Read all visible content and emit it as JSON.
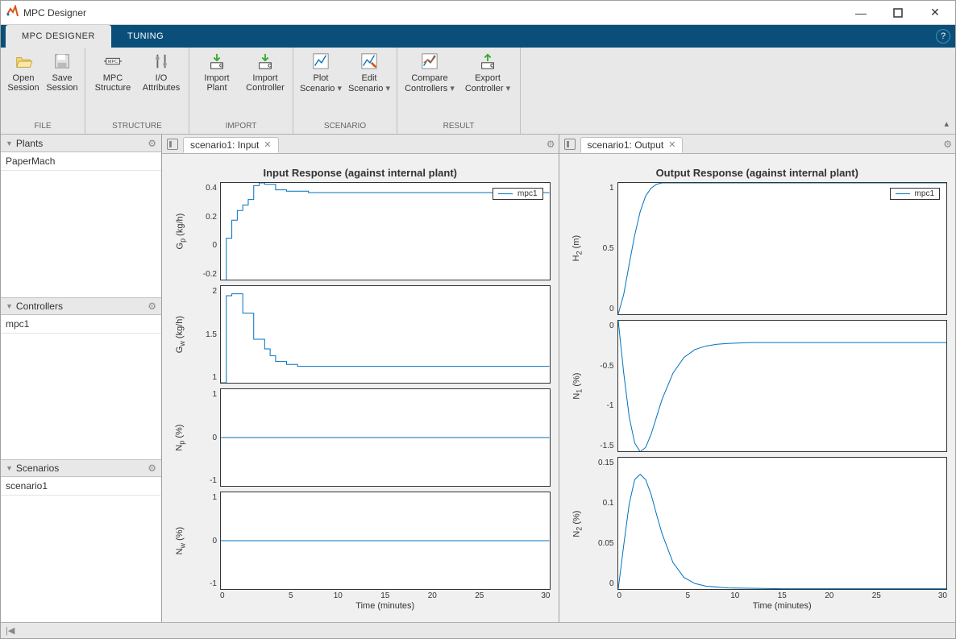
{
  "window": {
    "title": "MPC Designer"
  },
  "tabs": {
    "main": "MPC DESIGNER",
    "tuning": "TUNING"
  },
  "toolstrip": {
    "file": {
      "label": "FILE",
      "open": "Open\nSession",
      "save": "Save\nSession"
    },
    "structure": {
      "label": "STRUCTURE",
      "mpc": "MPC\nStructure",
      "io": "I/O\nAttributes"
    },
    "import": {
      "label": "IMPORT",
      "plant": "Import\nPlant",
      "controller": "Import\nController"
    },
    "scenario": {
      "label": "SCENARIO",
      "plot": "Plot\nScenario",
      "edit": "Edit\nScenario"
    },
    "result": {
      "label": "RESULT",
      "compare": "Compare\nControllers",
      "export": "Export\nController"
    }
  },
  "sidebar": {
    "plants": {
      "title": "Plants",
      "items": [
        "PaperMach"
      ]
    },
    "controllers": {
      "title": "Controllers",
      "items": [
        "mpc1"
      ]
    },
    "scenarios": {
      "title": "Scenarios",
      "items": [
        "scenario1"
      ]
    }
  },
  "panes": {
    "input": {
      "tab": "scenario1: Input",
      "title": "Input Response (against internal plant)",
      "legend": "mpc1"
    },
    "output": {
      "tab": "scenario1: Output",
      "title": "Output Response (against internal plant)",
      "legend": "mpc1"
    }
  },
  "xaxis": {
    "label": "Time (minutes)",
    "ticks": [
      "0",
      "5",
      "10",
      "15",
      "20",
      "25",
      "30"
    ]
  },
  "chart_data": {
    "input": [
      {
        "ylabel": "G_p  (kg/h)",
        "ylim": [
          -0.2,
          0.5
        ],
        "yticks": [
          -0.2,
          0,
          0.2,
          0.4
        ],
        "x": [
          0,
          0.5,
          1,
          1.5,
          2,
          2.5,
          3,
          3.5,
          4,
          5,
          6,
          8,
          10,
          15,
          20,
          25,
          30
        ],
        "y": [
          -0.25,
          0.1,
          0.23,
          0.3,
          0.34,
          0.38,
          0.48,
          0.5,
          0.49,
          0.45,
          0.44,
          0.43,
          0.43,
          0.43,
          0.43,
          0.43,
          0.43
        ],
        "step": true
      },
      {
        "ylabel": "G_w  (kg/h)",
        "ylim": [
          1.0,
          2.0
        ],
        "yticks": [
          1,
          1.5,
          2
        ],
        "x": [
          0,
          0.5,
          1,
          1.5,
          2,
          2.5,
          3,
          3.5,
          4,
          4.5,
          5,
          6,
          7,
          8,
          10,
          15,
          20,
          25,
          30
        ],
        "y": [
          1.0,
          1.9,
          1.92,
          1.92,
          1.72,
          1.72,
          1.45,
          1.45,
          1.35,
          1.28,
          1.22,
          1.19,
          1.17,
          1.17,
          1.17,
          1.17,
          1.17,
          1.17,
          1.17
        ],
        "step": true
      },
      {
        "ylabel": "N_p  (%)",
        "ylim": [
          -1,
          1
        ],
        "yticks": [
          -1,
          0,
          1
        ],
        "x": [
          0,
          30
        ],
        "y": [
          0,
          0
        ]
      },
      {
        "ylabel": "N_w  (%)",
        "ylim": [
          -1,
          1
        ],
        "yticks": [
          -1,
          0,
          1
        ],
        "x": [
          0,
          30
        ],
        "y": [
          0,
          0
        ]
      }
    ],
    "output": [
      {
        "ylabel": "H_2  (m)",
        "ylim": [
          0,
          1
        ],
        "yticks": [
          0,
          0.5,
          1
        ],
        "x": [
          0,
          0.5,
          1,
          1.5,
          2,
          2.5,
          3,
          3.5,
          4,
          5,
          6,
          8,
          10,
          15,
          20,
          25,
          30
        ],
        "y": [
          0,
          0.15,
          0.38,
          0.6,
          0.78,
          0.9,
          0.96,
          0.99,
          1.0,
          1.0,
          1.0,
          1.0,
          1.0,
          1.0,
          1.0,
          1.0,
          1.0
        ]
      },
      {
        "ylabel": "N_1  (%)",
        "ylim": [
          -1.5,
          0
        ],
        "yticks": [
          -1.5,
          -1,
          -0.5,
          0
        ],
        "x": [
          0,
          0.5,
          1,
          1.5,
          2,
          2.5,
          3,
          3.5,
          4,
          5,
          6,
          7,
          8,
          9,
          10,
          12,
          15,
          20,
          25,
          30
        ],
        "y": [
          0,
          -0.6,
          -1.1,
          -1.4,
          -1.5,
          -1.45,
          -1.3,
          -1.1,
          -0.9,
          -0.6,
          -0.42,
          -0.33,
          -0.29,
          -0.27,
          -0.26,
          -0.25,
          -0.25,
          -0.25,
          -0.25,
          -0.25
        ]
      },
      {
        "ylabel": "N_2  (%)",
        "ylim": [
          0,
          0.15
        ],
        "yticks": [
          0,
          0.05,
          0.1,
          0.15
        ],
        "x": [
          0,
          0.5,
          1,
          1.5,
          2,
          2.5,
          3,
          3.5,
          4,
          5,
          6,
          7,
          8,
          10,
          15,
          20,
          25,
          30
        ],
        "y": [
          0,
          0.05,
          0.097,
          0.125,
          0.131,
          0.125,
          0.108,
          0.085,
          0.063,
          0.03,
          0.013,
          0.006,
          0.003,
          0.001,
          0,
          0,
          0,
          0
        ]
      }
    ]
  }
}
